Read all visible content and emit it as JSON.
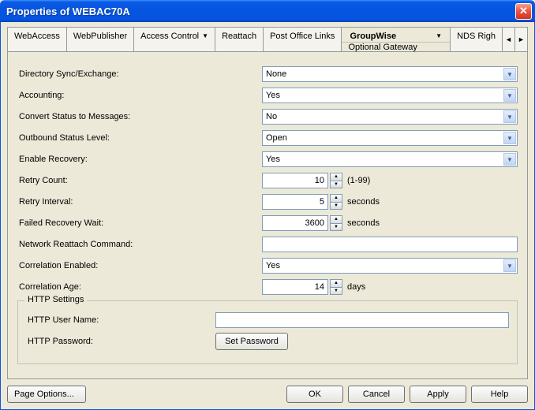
{
  "window": {
    "title": "Properties of WEBAC70A"
  },
  "tabs": {
    "webaccess": "WebAccess",
    "webpublisher": "WebPublisher",
    "access_control": "Access Control",
    "reattach": "Reattach",
    "post_office_links": "Post Office Links",
    "groupwise": "GroupWise",
    "groupwise_sub": "Optional Gateway Settings",
    "nds_rights": "NDS Righ"
  },
  "form": {
    "directory_sync": {
      "label": "Directory Sync/Exchange:",
      "value": "None"
    },
    "accounting": {
      "label": "Accounting:",
      "value": "Yes"
    },
    "convert_status": {
      "label": "Convert Status to Messages:",
      "value": "No"
    },
    "outbound_status": {
      "label": "Outbound Status Level:",
      "value": "Open"
    },
    "enable_recovery": {
      "label": "Enable Recovery:",
      "value": "Yes"
    },
    "retry_count": {
      "label": "Retry Count:",
      "value": "10",
      "suffix": "(1-99)"
    },
    "retry_interval": {
      "label": "Retry Interval:",
      "value": "5",
      "suffix": "seconds"
    },
    "failed_recovery": {
      "label": "Failed Recovery Wait:",
      "value": "3600",
      "suffix": "seconds"
    },
    "network_reattach": {
      "label": "Network Reattach Command:",
      "value": ""
    },
    "correlation_enabled": {
      "label": "Correlation Enabled:",
      "value": "Yes"
    },
    "correlation_age": {
      "label": "Correlation Age:",
      "value": "14",
      "suffix": "days"
    }
  },
  "http": {
    "legend": "HTTP Settings",
    "username_label": "HTTP User Name:",
    "password_label": "HTTP Password:",
    "set_password_btn": "Set Password"
  },
  "buttons": {
    "page_options": "Page Options...",
    "ok": "OK",
    "cancel": "Cancel",
    "apply": "Apply",
    "help": "Help"
  }
}
